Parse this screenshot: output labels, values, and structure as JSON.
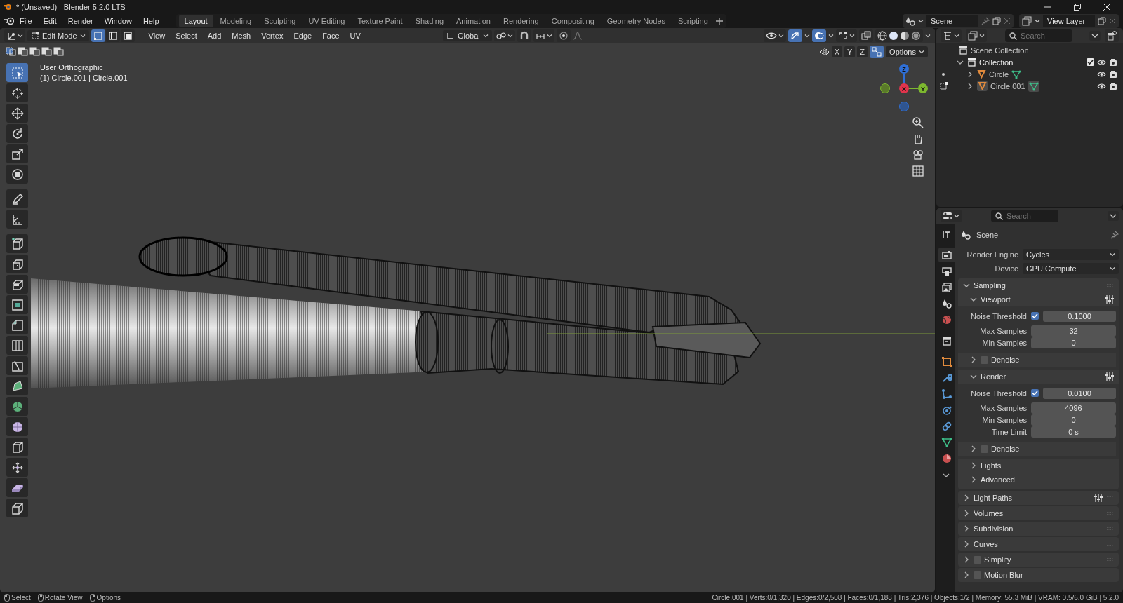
{
  "window": {
    "title": "* (Unsaved) - Blender 5.2.0 LTS"
  },
  "menu": [
    "File",
    "Edit",
    "Render",
    "Window",
    "Help"
  ],
  "workspaces": [
    {
      "label": "Layout",
      "selected": true
    },
    {
      "label": "Modeling",
      "selected": false
    },
    {
      "label": "Sculpting",
      "selected": false
    },
    {
      "label": "UV Editing",
      "selected": false
    },
    {
      "label": "Texture Paint",
      "selected": false
    },
    {
      "label": "Shading",
      "selected": false
    },
    {
      "label": "Animation",
      "selected": false
    },
    {
      "label": "Rendering",
      "selected": false
    },
    {
      "label": "Compositing",
      "selected": false
    },
    {
      "label": "Geometry Nodes",
      "selected": false
    },
    {
      "label": "Scripting",
      "selected": false
    }
  ],
  "scene": "Scene",
  "view_layer": "View Layer",
  "viewport_header": {
    "mode": "Edit Mode",
    "select_modes": [
      {
        "selected": true
      },
      {
        "selected": false
      },
      {
        "selected": false
      }
    ],
    "menus": [
      "View",
      "Select",
      "Add",
      "Mesh",
      "Vertex",
      "Edge",
      "Face",
      "UV"
    ],
    "orientation": "Global",
    "axes": [
      "X",
      "Y",
      "Z"
    ],
    "options": "Options"
  },
  "viewport": {
    "view_name": "User Orthographic",
    "object_info": "(1) Circle.001 | Circle.001",
    "gizmo_axes": [
      "Z",
      "X",
      "Y"
    ]
  },
  "tools": [
    {
      "selected": true
    },
    {
      "selected": false
    },
    {
      "selected": false
    },
    {
      "selected": false
    },
    {
      "selected": false
    },
    {
      "selected": false
    },
    {
      "selected": false
    },
    {
      "selected": false
    },
    {
      "selected": false
    },
    {
      "selected": false
    },
    {
      "selected": false
    },
    {
      "selected": false
    },
    {
      "selected": false
    },
    {
      "selected": false
    },
    {
      "selected": false
    },
    {
      "selected": false
    },
    {
      "selected": false
    },
    {
      "selected": false
    },
    {
      "selected": false
    },
    {
      "selected": false
    },
    {
      "selected": false
    },
    {
      "selected": false
    }
  ],
  "outliner": {
    "search": {
      "placeholder": "Search"
    },
    "tree": [
      {
        "kind": "scene_collection",
        "label": "Scene Collection",
        "children": [
          {
            "kind": "collection",
            "label": "Collection",
            "expanded": true,
            "checked": true,
            "children": [
              {
                "kind": "mesh_object",
                "label": "Circle",
                "expanded": false,
                "active": false
              },
              {
                "kind": "mesh_object",
                "label": "Circle.001",
                "expanded": false,
                "active": true
              }
            ]
          }
        ]
      }
    ]
  },
  "properties": {
    "search": {
      "placeholder": "Search"
    },
    "tabs": [
      {
        "selected": false
      },
      {
        "selected": true
      },
      {
        "selected": false
      },
      {
        "selected": false
      },
      {
        "selected": false
      },
      {
        "selected": false
      },
      {
        "selected": false
      },
      {
        "selected": false
      },
      {
        "selected": false
      },
      {
        "selected": false
      },
      {
        "selected": false
      },
      {
        "selected": false
      },
      {
        "selected": false
      },
      {
        "selected": false
      }
    ],
    "context": "Scene",
    "fields": [
      {
        "label": "Render Engine",
        "value": "Cycles"
      },
      {
        "label": "Device",
        "value": "GPU Compute"
      }
    ],
    "sampling": {
      "label": "Sampling",
      "expanded": true,
      "subpanels": [
        {
          "label": "Viewport",
          "expanded": true,
          "presets": true,
          "fields": [
            {
              "label": "Noise Threshold",
              "checked": true,
              "value": "0.1000"
            },
            {
              "label": "Max Samples",
              "value": "32"
            },
            {
              "label": "Min Samples",
              "value": "0"
            }
          ],
          "children": [
            {
              "label": "Denoise",
              "expanded": false,
              "checked": false
            }
          ]
        },
        {
          "label": "Render",
          "expanded": true,
          "presets": true,
          "fields": [
            {
              "label": "Noise Threshold",
              "checked": true,
              "value": "0.0100"
            },
            {
              "label": "Max Samples",
              "value": "4096"
            },
            {
              "label": "Min Samples",
              "value": "0"
            },
            {
              "label": "Time Limit",
              "value": "0 s"
            }
          ],
          "children": [
            {
              "label": "Denoise",
              "expanded": false,
              "checked": false
            }
          ]
        },
        {
          "label": "Lights",
          "expanded": false
        },
        {
          "label": "Advanced",
          "expanded": false
        }
      ]
    },
    "panels": [
      {
        "label": "Light Paths",
        "expanded": false,
        "presets": true
      },
      {
        "label": "Volumes",
        "expanded": false
      },
      {
        "label": "Subdivision",
        "expanded": false
      },
      {
        "label": "Curves",
        "expanded": false
      },
      {
        "label": "Simplify",
        "expanded": false,
        "checked": false
      },
      {
        "label": "Motion Blur",
        "expanded": false,
        "checked": false
      }
    ]
  },
  "status_bar": {
    "hints": [
      "Select",
      "Rotate View",
      "Options"
    ],
    "stats": "Circle.001 | Verts:0/1,320 | Edges:0/2,508 | Faces:0/1,188 | Tris:2,376 | Objects:1/2 | Memory: 55.3 MiB | VRAM: 0.5/6.0 GiB | 5.2.0"
  }
}
